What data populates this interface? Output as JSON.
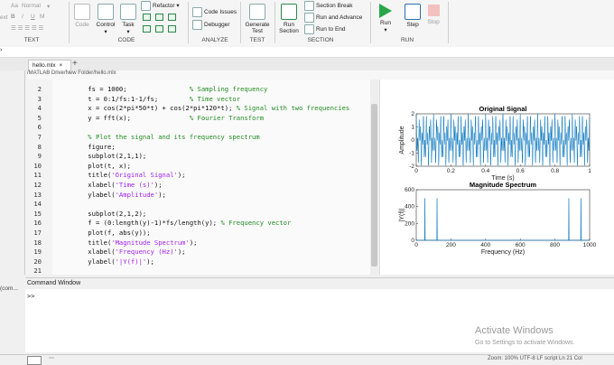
{
  "ribbon": {
    "text_partial": "ext",
    "style_value": "Normal",
    "aa_label": "Aa",
    "code_label": "Code",
    "control_label": "Control",
    "task_label": "Task",
    "refactor_label": "Refactor",
    "code_issues_label": "Code Issues",
    "debugger_label": "Debugger",
    "generate_test_label": "Generate Test",
    "run_section_label": "Run Section",
    "section_break_label": "Section Break",
    "run_and_advance_label": "Run and Advance",
    "run_to_end_label": "Run to End",
    "run_label": "Run",
    "step_label": "Step",
    "stop_label": "Stop",
    "sections": [
      "TEXT",
      "CODE",
      "ANALYZE",
      "TEST",
      "SECTION",
      "RUN"
    ]
  },
  "editor": {
    "tab_label": "hello.mlx",
    "add_tab": "+",
    "path": "/MATLAB Drive/New Folder/hello.mlx",
    "lines": [
      {
        "n": "2",
        "code": "    fs = 1000;",
        "comment": "% Sampling frequency",
        "ccol": 20
      },
      {
        "n": "3",
        "code": "    t = 0:1/fs:1-1/fs;",
        "comment": "% Time vector",
        "ccol": 20
      },
      {
        "n": "4",
        "code": "    x = cos(2*pi*50*t) + cos(2*pi*120*t);",
        "comment": "% Signal with two frequencies",
        "ccol": 0
      },
      {
        "n": "5",
        "code": "    y = fft(x);",
        "comment": "% Fourier Transform",
        "ccol": 20
      },
      {
        "n": "6",
        "code": "",
        "comment": "",
        "ccol": 0
      },
      {
        "n": "7",
        "code": "",
        "comment": "    % Plot the signal and its frequency spectrum",
        "ccol": 0
      },
      {
        "n": "8",
        "code": "    figure;",
        "comment": "",
        "ccol": 0
      },
      {
        "n": "9",
        "code": "    subplot(2,1,1);",
        "comment": "",
        "ccol": 0
      },
      {
        "n": "10",
        "code": "    plot(t, x);",
        "comment": "",
        "ccol": 0
      },
      {
        "n": "11",
        "code": "    title(",
        "str": "'Original Signal'",
        "tail": ");",
        "ccol": 0
      },
      {
        "n": "12",
        "code": "    xlabel(",
        "str": "'Time (s)'",
        "tail": ");",
        "ccol": 0
      },
      {
        "n": "13",
        "code": "    ylabel(",
        "str": "'Amplitude'",
        "tail": ");",
        "ccol": 0
      },
      {
        "n": "14",
        "code": "",
        "comment": "",
        "ccol": 0
      },
      {
        "n": "15",
        "code": "    subplot(2,1,2);",
        "comment": "",
        "ccol": 0
      },
      {
        "n": "16",
        "code": "    f = (0:length(y)-1)*fs/length(y);",
        "comment": "% Frequency vector",
        "ccol": 0
      },
      {
        "n": "17",
        "code": "    plot(f, abs(y));",
        "comment": "",
        "ccol": 0
      },
      {
        "n": "18",
        "code": "    title(",
        "str": "'Magnitude Spectrum'",
        "tail": ");",
        "ccol": 0
      },
      {
        "n": "19",
        "code": "    xlabel(",
        "str": "'Frequency (Hz)'",
        "tail": ");",
        "ccol": 0
      },
      {
        "n": "20",
        "code": "    ylabel(",
        "str": "'|Y(f)|'",
        "tail": ");",
        "ccol": 0
      },
      {
        "n": "21",
        "code": "",
        "comment": "",
        "ccol": 0
      }
    ]
  },
  "figure": {
    "top_title": "Original Signal",
    "top_xlabel": "Time (s)",
    "top_ylabel": "Amplitude",
    "top_xticks": [
      "0",
      "0.2",
      "0.4",
      "0.6",
      "0.8",
      "1"
    ],
    "top_yticks": [
      "2",
      "1",
      "0",
      "-1",
      "-2"
    ],
    "bottom_title": "Magnitude Spectrum",
    "bottom_xlabel": "Frequency (Hz)",
    "bottom_ylabel": "|Y(f)|",
    "bottom_xticks": [
      "0",
      "200",
      "400",
      "600",
      "800",
      "1000"
    ],
    "bottom_yticks": [
      "600",
      "400",
      "200",
      "0"
    ],
    "line_color": "#0072bd"
  },
  "chart_data": [
    {
      "type": "line",
      "title": "Original Signal",
      "xlabel": "Time (s)",
      "ylabel": "Amplitude",
      "xlim": [
        0,
        1
      ],
      "ylim": [
        -2,
        2
      ],
      "series": [
        {
          "formula": "cos(2*pi*50*t) + cos(2*pi*120*t)",
          "fs": 1000
        }
      ]
    },
    {
      "type": "line",
      "title": "Magnitude Spectrum",
      "xlabel": "Frequency (Hz)",
      "ylabel": "|Y(f)|",
      "xlim": [
        0,
        1000
      ],
      "ylim": [
        0,
        600
      ],
      "peaks": [
        {
          "x": 50,
          "y": 500
        },
        {
          "x": 120,
          "y": 500
        },
        {
          "x": 880,
          "y": 500
        },
        {
          "x": 950,
          "y": 500
        }
      ]
    }
  ],
  "command_window": {
    "title": "Command Window",
    "prompt": ">>",
    "left_label": "(com..."
  },
  "watermark": {
    "title": "Activate Windows",
    "subtitle": "Go to Settings to activate Windows."
  },
  "status": {
    "text": "Zoom: 100%   UTF-8   LF   script   Ln 21  Col"
  }
}
